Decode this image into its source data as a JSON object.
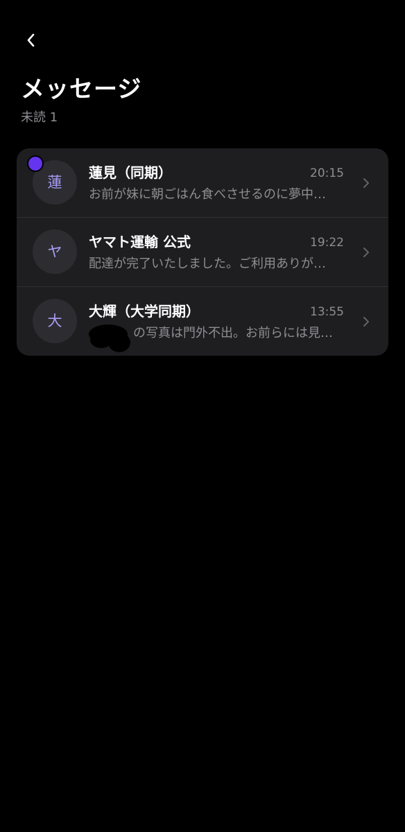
{
  "header": {
    "back_icon": "chevron-left-icon",
    "title": "メッセージ",
    "unread_label": "未読 1"
  },
  "messages": [
    {
      "avatar": "蓮",
      "name": "蓮見（同期）",
      "time": "20:15",
      "preview": "お前が妹に朝ごはん食べさせるのに夢中…",
      "unread": true
    },
    {
      "avatar": "ヤ",
      "name": "ヤマト運輸 公式",
      "time": "19:22",
      "preview": "配達が完了いたしました。ご利用ありが…",
      "unread": false
    },
    {
      "avatar": "大",
      "name": "大輝（大学同期）",
      "time": "13:55",
      "preview": "の写真は門外不出。お前らには見…",
      "unread": false,
      "redacted_prefix": true
    }
  ],
  "colors": {
    "background": "#000000",
    "card": "#1e1e21",
    "avatar_bg": "#2d2d31",
    "avatar_text": "#a99cf7",
    "unread_dot": "#6534ee",
    "secondary_text": "#8e8e93"
  }
}
